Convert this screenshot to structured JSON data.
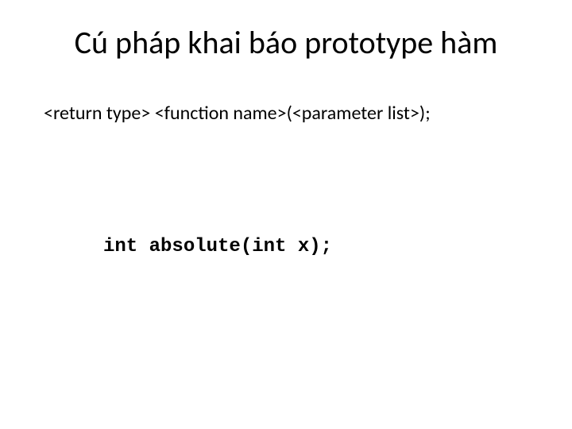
{
  "slide": {
    "title": "Cú pháp khai báo prototype hàm",
    "syntax": "<return type> <function name>(<parameter list>);",
    "code_example": "int absolute(int x);"
  }
}
